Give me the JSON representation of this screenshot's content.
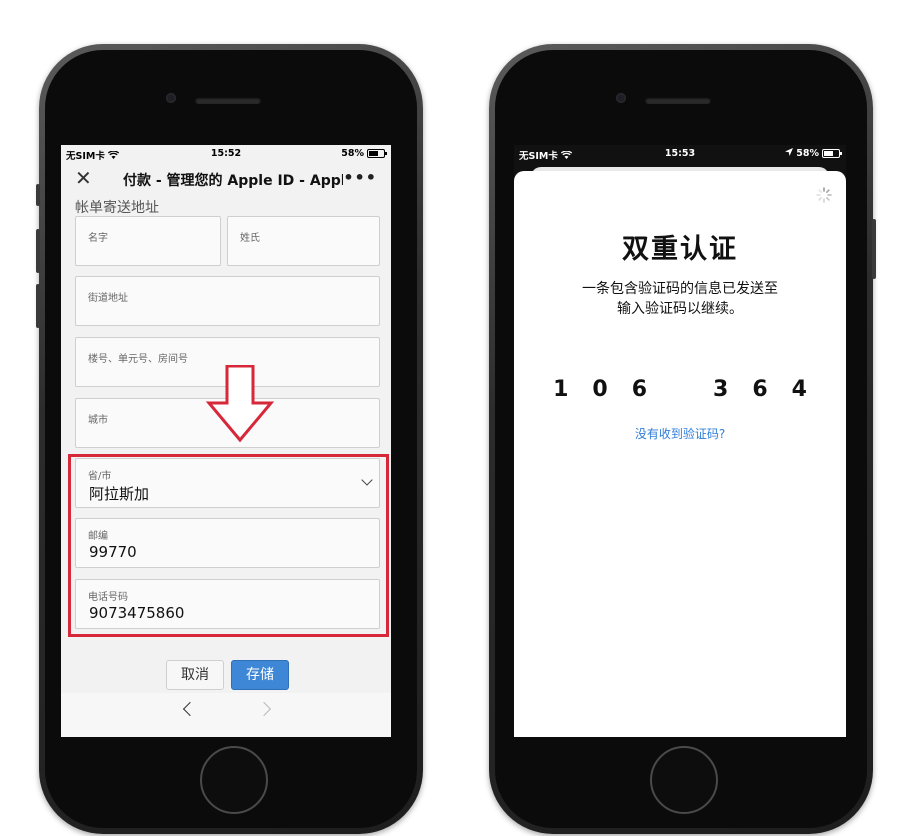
{
  "left_phone": {
    "status": {
      "carrier": "无SIM卡",
      "time": "15:52",
      "battery": "58%"
    },
    "nav": {
      "close_glyph": "✕",
      "title": "付款 - 管理您的 Apple ID - Apple",
      "more_glyph": "•••"
    },
    "section_title": "帐单寄送地址",
    "fields": {
      "first_name": {
        "label": "名字",
        "value": ""
      },
      "last_name": {
        "label": "姓氏",
        "value": ""
      },
      "street": {
        "label": "街道地址",
        "value": ""
      },
      "unit": {
        "label": "楼号、单元号、房间号",
        "value": ""
      },
      "city": {
        "label": "城市",
        "value": ""
      },
      "province": {
        "label": "省/市",
        "value": "阿拉斯加"
      },
      "zip": {
        "label": "邮编",
        "value": "99770"
      },
      "phone": {
        "label": "电话号码",
        "value": "9073475860"
      }
    },
    "buttons": {
      "cancel": "取消",
      "save": "存储"
    },
    "highlight_color": "#d7283a"
  },
  "right_phone": {
    "status": {
      "carrier": "无SIM卡",
      "time": "15:53",
      "battery": "58%"
    },
    "title": "双重认证",
    "message_line1": "一条包含验证码的信息已发送至",
    "message_line2": "输入验证码以继续。",
    "code": [
      "1",
      "0",
      "6",
      "3",
      "6",
      "4"
    ],
    "resend_link": "没有收到验证码?",
    "link_color": "#2f7ed8"
  }
}
